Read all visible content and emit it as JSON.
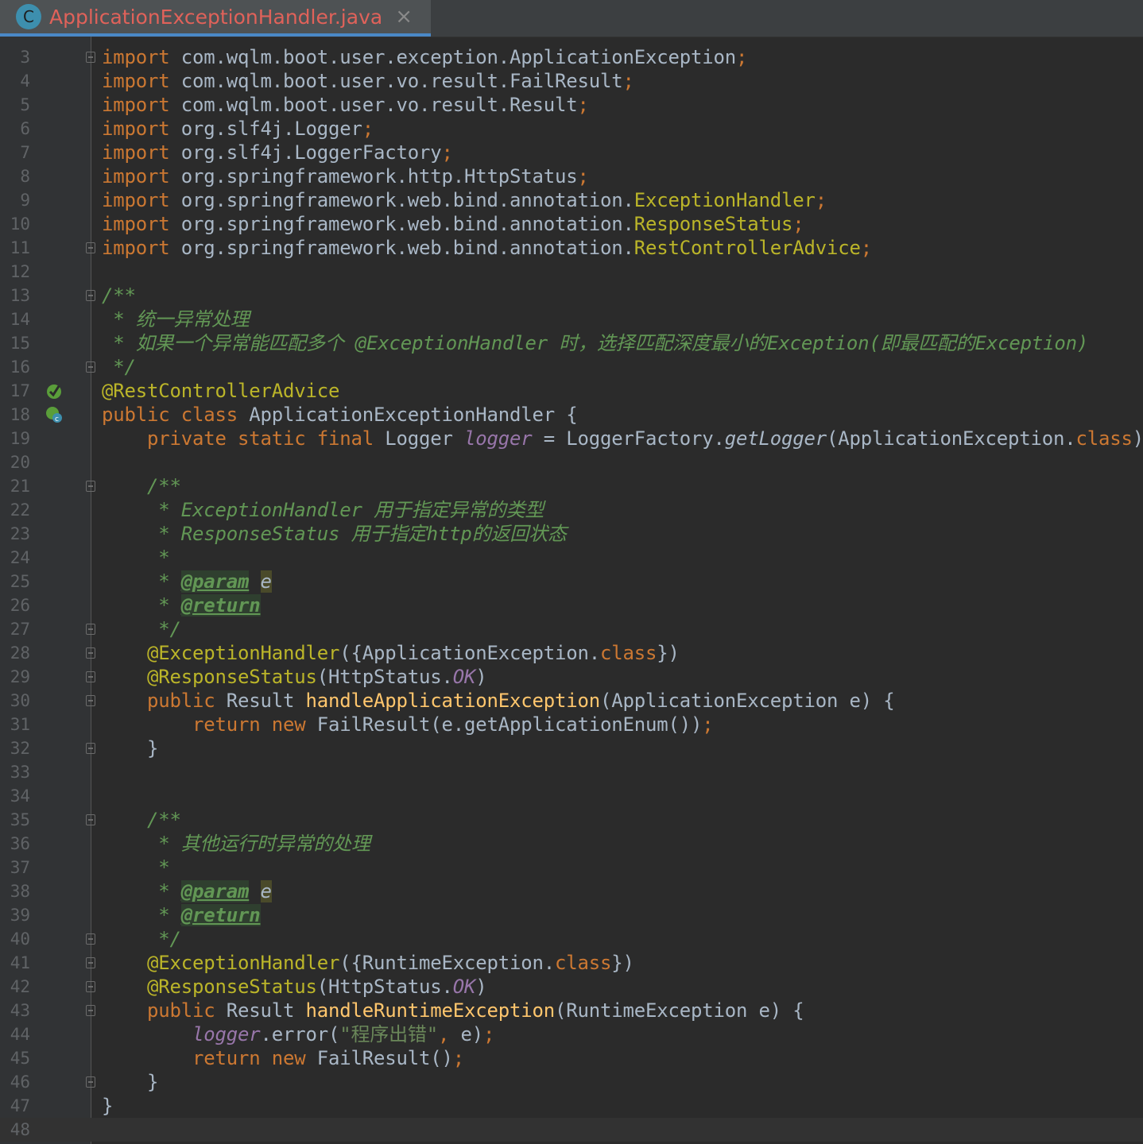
{
  "tab": {
    "icon_letter": "C",
    "title": "ApplicationExceptionHandler.java",
    "close_glyph": "×"
  },
  "lines": [
    {
      "n": "3",
      "t": "import com.wqlm.boot.user.exception.ApplicationException;"
    },
    {
      "n": "4",
      "t": "import com.wqlm.boot.user.vo.result.FailResult;"
    },
    {
      "n": "5",
      "t": "import com.wqlm.boot.user.vo.result.Result;"
    },
    {
      "n": "6",
      "t": "import org.slf4j.Logger;"
    },
    {
      "n": "7",
      "t": "import org.slf4j.LoggerFactory;"
    },
    {
      "n": "8",
      "t": "import org.springframework.http.HttpStatus;"
    },
    {
      "n": "9",
      "t": "import org.springframework.web.bind.annotation.ExceptionHandler;"
    },
    {
      "n": "10",
      "t": "import org.springframework.web.bind.annotation.ResponseStatus;"
    },
    {
      "n": "11",
      "t": "import org.springframework.web.bind.annotation.RestControllerAdvice;"
    },
    {
      "n": "12",
      "t": ""
    },
    {
      "n": "13",
      "t": "/**"
    },
    {
      "n": "14",
      "t": " * 统一异常处理"
    },
    {
      "n": "15",
      "t": " * 如果一个异常能匹配多个 @ExceptionHandler 时，选择匹配深度最小的Exception(即最匹配的Exception)"
    },
    {
      "n": "16",
      "t": " */"
    },
    {
      "n": "17",
      "t": "@RestControllerAdvice"
    },
    {
      "n": "18",
      "t": "public class ApplicationExceptionHandler {"
    },
    {
      "n": "19",
      "t": "    private static final Logger logger = LoggerFactory.getLogger(ApplicationException.class);"
    },
    {
      "n": "20",
      "t": ""
    },
    {
      "n": "21",
      "t": "    /**"
    },
    {
      "n": "22",
      "t": "     * ExceptionHandler 用于指定异常的类型"
    },
    {
      "n": "23",
      "t": "     * ResponseStatus 用于指定http的返回状态"
    },
    {
      "n": "24",
      "t": "     *"
    },
    {
      "n": "25",
      "t": "     * @param e"
    },
    {
      "n": "26",
      "t": "     * @return"
    },
    {
      "n": "27",
      "t": "     */"
    },
    {
      "n": "28",
      "t": "    @ExceptionHandler({ApplicationException.class})"
    },
    {
      "n": "29",
      "t": "    @ResponseStatus(HttpStatus.OK)"
    },
    {
      "n": "30",
      "t": "    public Result handleApplicationException(ApplicationException e) {"
    },
    {
      "n": "31",
      "t": "        return new FailResult(e.getApplicationEnum());"
    },
    {
      "n": "32",
      "t": "    }"
    },
    {
      "n": "33",
      "t": ""
    },
    {
      "n": "34",
      "t": ""
    },
    {
      "n": "35",
      "t": "    /**"
    },
    {
      "n": "36",
      "t": "     * 其他运行时异常的处理"
    },
    {
      "n": "37",
      "t": "     *"
    },
    {
      "n": "38",
      "t": "     * @param e"
    },
    {
      "n": "39",
      "t": "     * @return"
    },
    {
      "n": "40",
      "t": "     */"
    },
    {
      "n": "41",
      "t": "    @ExceptionHandler({RuntimeException.class})"
    },
    {
      "n": "42",
      "t": "    @ResponseStatus(HttpStatus.OK)"
    },
    {
      "n": "43",
      "t": "    public Result handleRuntimeException(RuntimeException e) {"
    },
    {
      "n": "44",
      "t": "        logger.error(\"程序出错\", e);"
    },
    {
      "n": "45",
      "t": "        return new FailResult();"
    },
    {
      "n": "46",
      "t": "    }"
    },
    {
      "n": "47",
      "t": "}"
    },
    {
      "n": "48",
      "t": ""
    }
  ],
  "gutter_icons": {
    "17": "spring-bean-icon",
    "18": "spring-class-icon"
  },
  "fold_lines": [
    "3",
    "11",
    "13",
    "16",
    "21",
    "27",
    "28",
    "29",
    "30",
    "32",
    "35",
    "40",
    "41",
    "42",
    "43",
    "46"
  ],
  "colors": {
    "background": "#2b2b2b",
    "keyword": "#cc7832",
    "annotation": "#bbb529",
    "doc_comment": "#629755",
    "method": "#ffc66d",
    "field": "#9876aa",
    "string": "#6a8759",
    "tab_title": "#e0625a"
  }
}
